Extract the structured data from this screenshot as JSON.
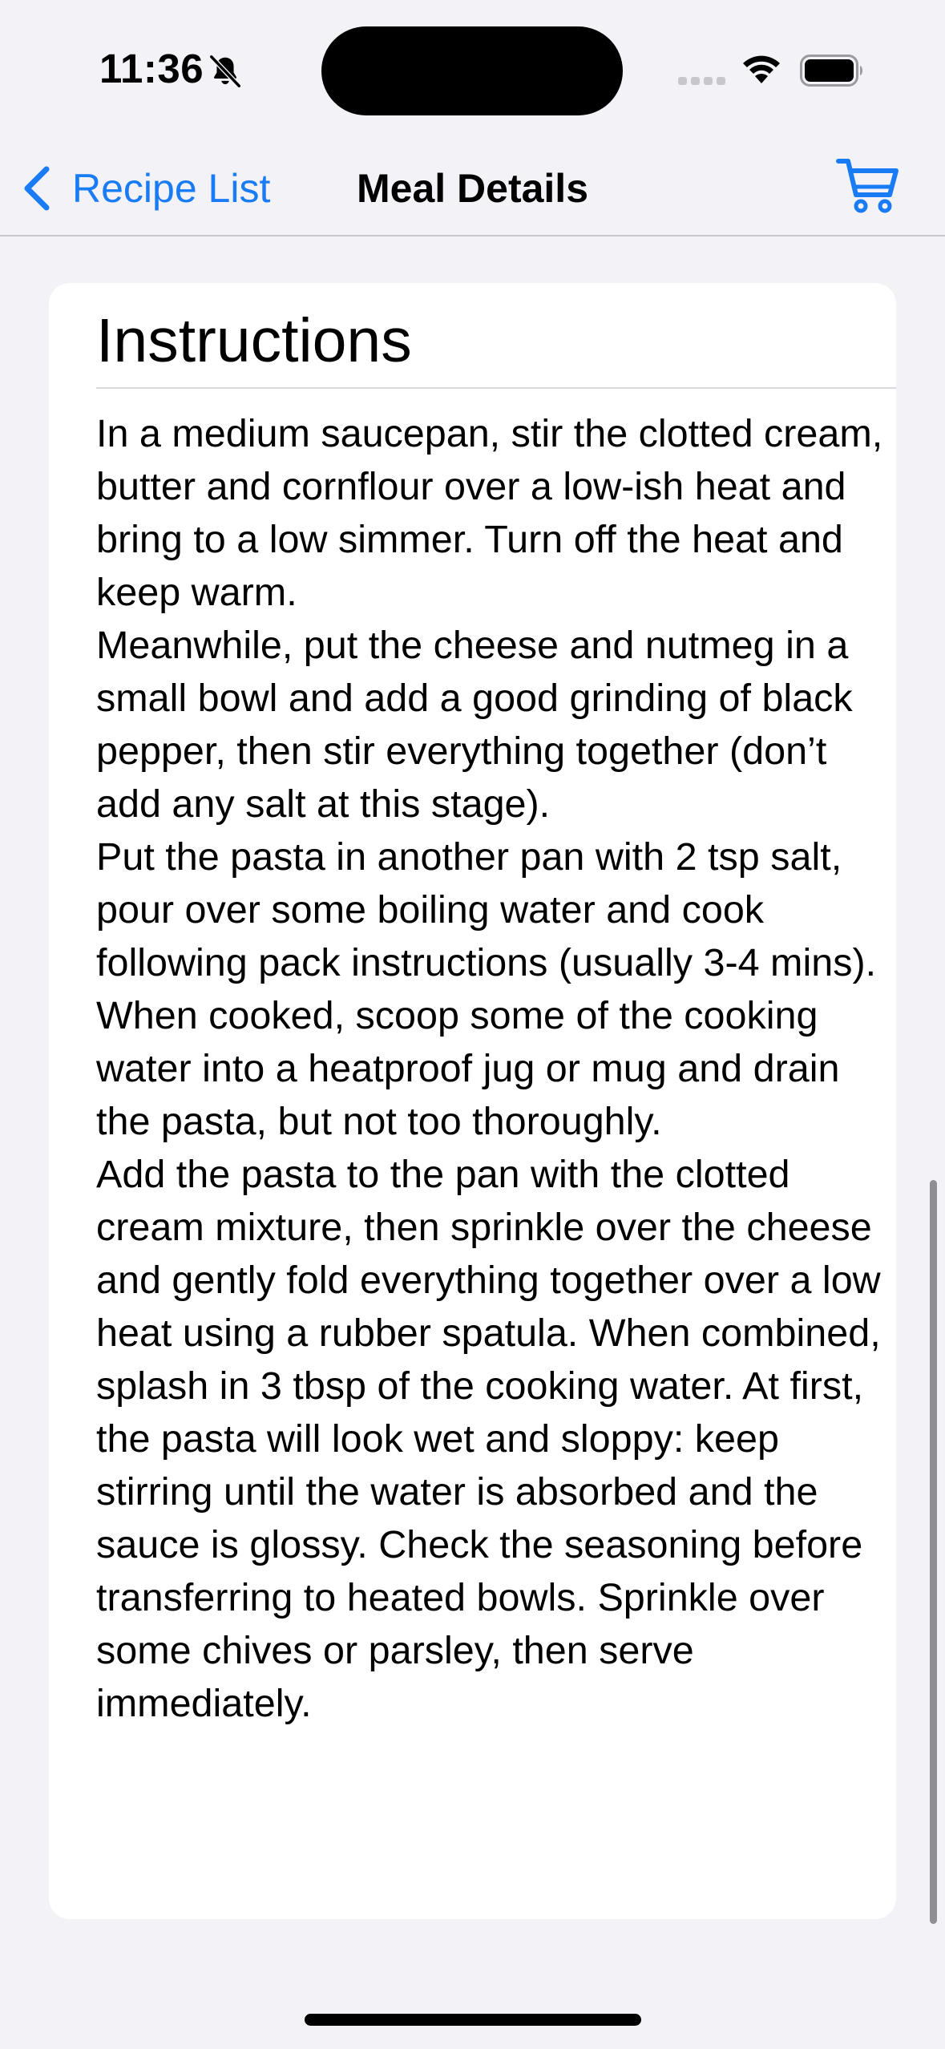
{
  "status_bar": {
    "time": "11:36",
    "icons": [
      "bell-slash-icon",
      "cellular-signal-icon",
      "wifi-icon",
      "battery-icon"
    ]
  },
  "nav": {
    "back_label": "Recipe List",
    "title": "Meal Details",
    "back_icon": "chevron-left-icon",
    "cart_icon": "cart-icon"
  },
  "card": {
    "title": "Instructions",
    "text": "In a medium saucepan, stir the clotted cream, butter and cornflour over a low-ish heat and bring to a low simmer. Turn off the heat and keep warm.\nMeanwhile, put the cheese and nutmeg in a small bowl and add a good grinding of black pepper, then stir everything together (don’t add any salt at this stage).\nPut the pasta in another pan with 2 tsp salt, pour over some boiling water and cook following pack instructions (usually 3-4 mins). When cooked, scoop some of the cooking water into a heatproof jug or mug and drain the pasta, but not too thoroughly.\nAdd the pasta to the pan with the clotted cream mixture, then sprinkle over the cheese and gently fold everything together over a low heat using a rubber spatula. When combined, splash in 3 tbsp of the cooking water. At first, the pasta will look wet and sloppy: keep stirring until the water is absorbed and the sauce is glossy. Check the seasoning before transferring to heated bowls. Sprinkle over some chives or parsley, then serve immediately."
  },
  "colors": {
    "accent": "#1a7cf5",
    "background": "#f2f2f7",
    "card": "#ffffff"
  }
}
